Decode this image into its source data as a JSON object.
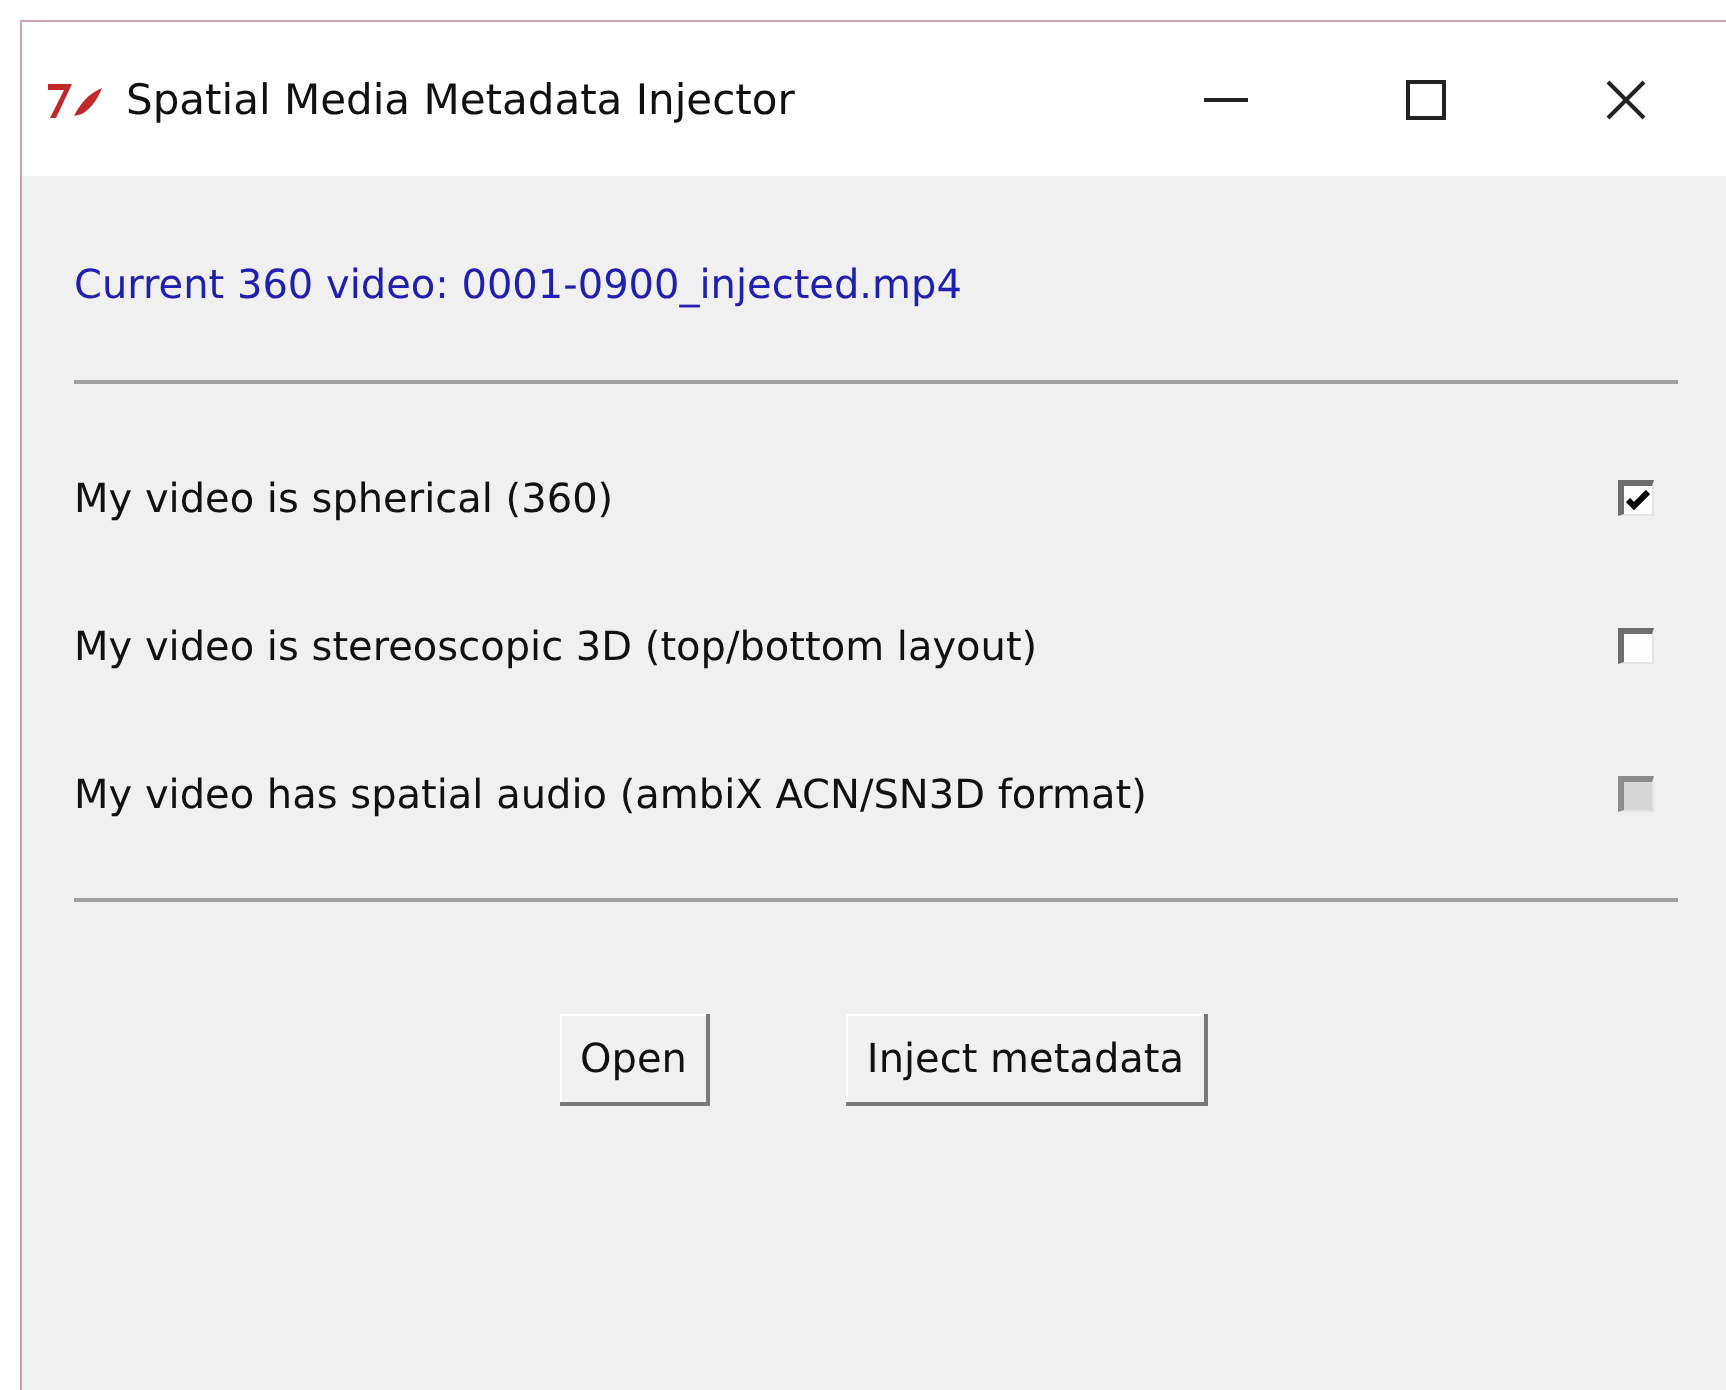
{
  "window": {
    "title": "Spatial Media Metadata Injector"
  },
  "current_file": "Current 360 video: 0001-0900_injected.mp4",
  "options": [
    {
      "label": "My video is spherical (360)",
      "checked": true,
      "disabled": false
    },
    {
      "label": "My video is stereoscopic 3D (top/bottom layout)",
      "checked": false,
      "disabled": false
    },
    {
      "label": "My video has spatial audio (ambiX ACN/SN3D format)",
      "checked": false,
      "disabled": true
    }
  ],
  "buttons": [
    "Open",
    "Inject metadata"
  ]
}
